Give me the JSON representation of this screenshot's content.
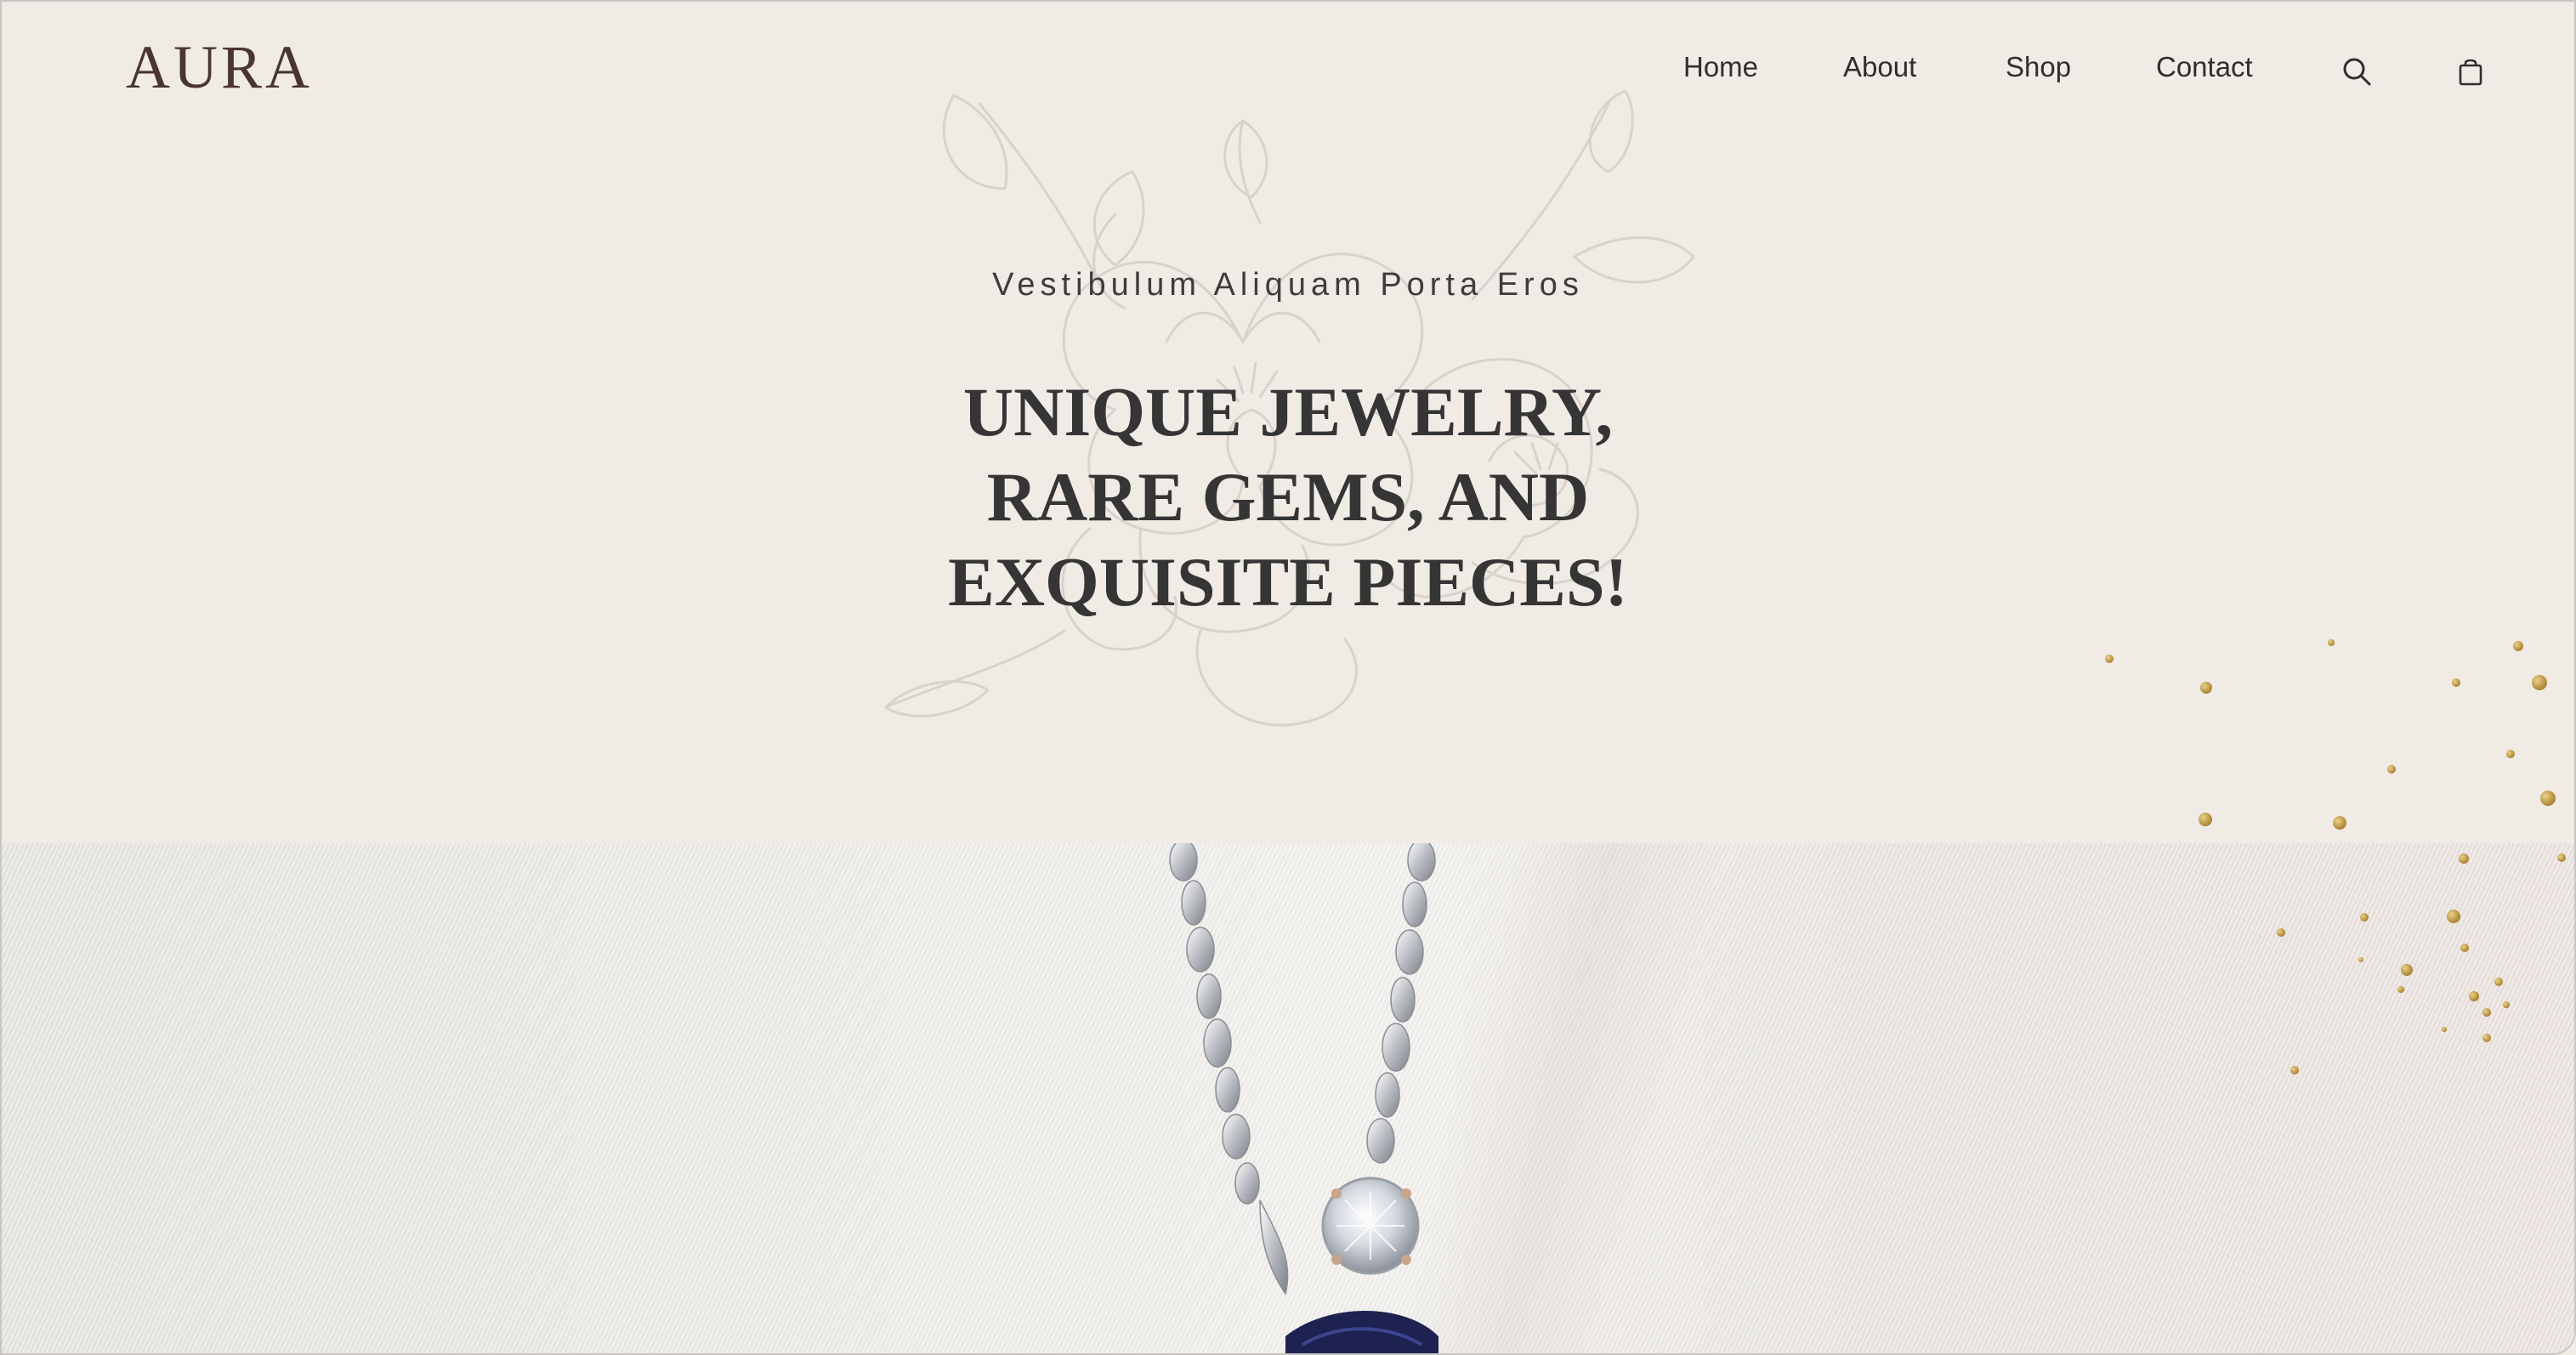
{
  "brand": {
    "logo_text": "AURA"
  },
  "nav": {
    "items": [
      {
        "label": "Home"
      },
      {
        "label": "About"
      },
      {
        "label": "Shop"
      },
      {
        "label": "Contact"
      }
    ],
    "icons": [
      "search-icon",
      "shopping-bag-icon"
    ]
  },
  "hero": {
    "eyebrow": "Vestibulum Aliquam Porta Eros",
    "headline_lines": [
      "UNIQUE JEWELRY,",
      "RARE GEMS, AND",
      "EXQUISITE PIECES!"
    ],
    "decoration": "magnolia-line-drawing"
  },
  "photo": {
    "subject": "silver-necklace-with-crystal-pendant"
  },
  "colors": {
    "background": "#f1ebe6",
    "text": "#353535",
    "logo": "#4a3530",
    "gold_accent": "#b58e3c"
  }
}
